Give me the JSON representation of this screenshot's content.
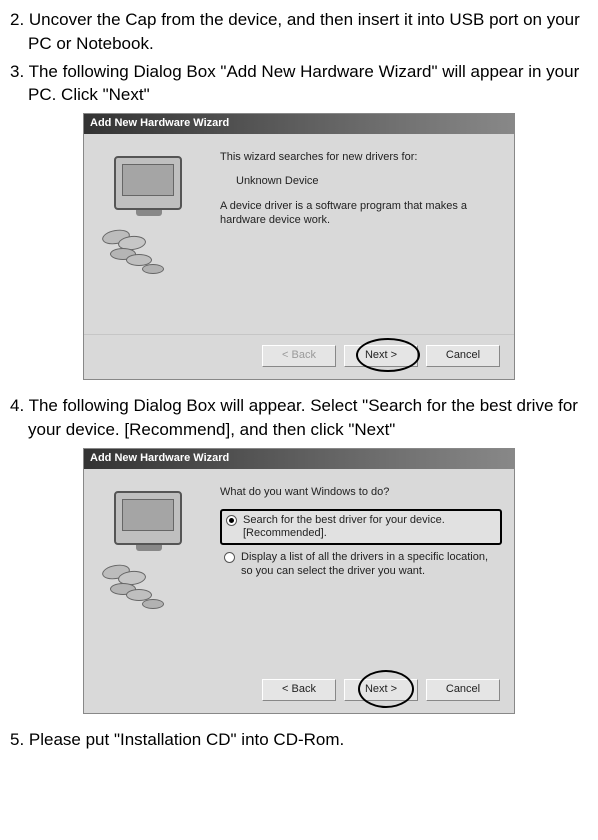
{
  "steps": {
    "s2": "2. Uncover the Cap from the device, and then insert it into USB port on your PC or Notebook.",
    "s3": "3. The following Dialog Box \"Add New Hardware Wizard\" will appear in your PC.  Click \"Next\"",
    "s4": "4. The following Dialog Box will appear. Select \"Search for the best drive for your device. [Recommend], and then click \"Next\"",
    "s5": "5. Please put \"Installation CD\" into CD-Rom."
  },
  "dlg1": {
    "title": "Add New Hardware Wizard",
    "line1": "This wizard searches for new drivers for:",
    "device": "Unknown Device",
    "line2": "A device driver is a software program that makes a hardware device work.",
    "back": "< Back",
    "next": "Next >",
    "cancel": "Cancel"
  },
  "dlg2": {
    "title": "Add New Hardware Wizard",
    "prompt": "What do you want Windows to do?",
    "opt1": "Search for the best driver for your device. [Recommended].",
    "opt2": "Display a list of all the drivers in a specific location, so you can select the driver you want.",
    "back": "< Back",
    "next": "Next >",
    "cancel": "Cancel"
  }
}
